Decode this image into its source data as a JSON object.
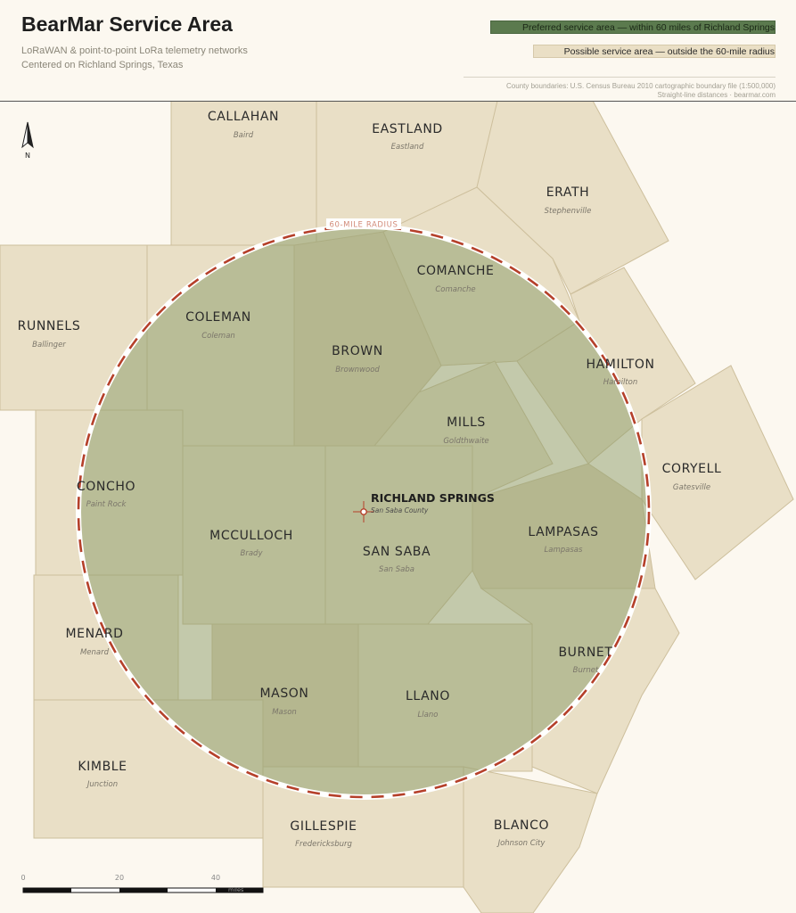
{
  "header": {
    "title": "BearMar Service Area",
    "subtitle_line1": "LoRaWAN & point-to-point LoRa telemetry networks",
    "subtitle_line2": "Centered on Richland Springs, Texas",
    "credit_line1": "County boundaries: U.S. Census Bureau 2010 cartographic boundary file (1:500,000)",
    "credit_line2": "Straight-line distances · bearmar.com"
  },
  "legend": {
    "preferred": {
      "label": "Preferred service area — within 60 miles of Richland Springs",
      "color": "#5b7a4e"
    },
    "possible": {
      "label": "Possible service area — outside the 60-mile radius",
      "color": "#eadfc5"
    }
  },
  "map": {
    "radius_label": "60-MILE RADIUS",
    "radius_color": "#b5402a",
    "north_label": "N",
    "center": {
      "name": "RICHLAND SPRINGS",
      "sub": "San Saba County"
    },
    "counties": [
      {
        "id": "callahan",
        "name": "CALLAHAN",
        "seat": "Baird"
      },
      {
        "id": "eastland",
        "name": "EASTLAND",
        "seat": "Eastland"
      },
      {
        "id": "erath",
        "name": "ERATH",
        "seat": "Stephenville"
      },
      {
        "id": "runnels",
        "name": "RUNNELS",
        "seat": "Ballinger"
      },
      {
        "id": "coleman",
        "name": "COLEMAN",
        "seat": "Coleman"
      },
      {
        "id": "brown",
        "name": "BROWN",
        "seat": "Brownwood"
      },
      {
        "id": "comanche",
        "name": "COMANCHE",
        "seat": "Comanche"
      },
      {
        "id": "hamilton",
        "name": "HAMILTON",
        "seat": "Hamilton"
      },
      {
        "id": "mills",
        "name": "MILLS",
        "seat": "Goldthwaite"
      },
      {
        "id": "coryell",
        "name": "CORYELL",
        "seat": "Gatesville"
      },
      {
        "id": "concho",
        "name": "CONCHO",
        "seat": "Paint Rock"
      },
      {
        "id": "mcculloch",
        "name": "MCCULLOCH",
        "seat": "Brady"
      },
      {
        "id": "sansaba",
        "name": "SAN SABA",
        "seat": "San Saba"
      },
      {
        "id": "lampasas",
        "name": "LAMPASAS",
        "seat": "Lampasas"
      },
      {
        "id": "menard",
        "name": "MENARD",
        "seat": "Menard"
      },
      {
        "id": "burnet",
        "name": "BURNET",
        "seat": "Burnet"
      },
      {
        "id": "mason",
        "name": "MASON",
        "seat": "Mason"
      },
      {
        "id": "llano",
        "name": "LLANO",
        "seat": "Llano"
      },
      {
        "id": "kimble",
        "name": "KIMBLE",
        "seat": "Junction"
      },
      {
        "id": "gillespie",
        "name": "GILLESPIE",
        "seat": "Fredericksburg"
      },
      {
        "id": "blanco",
        "name": "BLANCO",
        "seat": "Johnson City"
      }
    ]
  },
  "scale_bar": {
    "ticks": [
      "0",
      "20",
      "40"
    ],
    "unit": "miles"
  }
}
